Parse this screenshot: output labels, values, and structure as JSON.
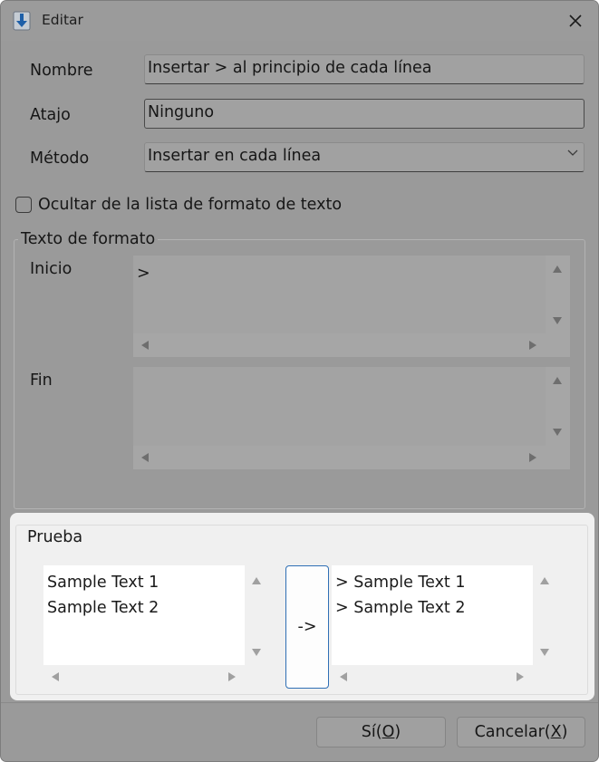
{
  "window": {
    "title": "Editar"
  },
  "form": {
    "nombre_label": "Nombre",
    "nombre_value": "Insertar > al principio de cada línea",
    "atajo_label": "Atajo",
    "atajo_value": "Ninguno",
    "metodo_label": "Método",
    "metodo_value": "Insertar en cada línea",
    "hide_checkbox_label": "Ocultar de la lista de formato de texto",
    "hide_checked": false
  },
  "format_group": {
    "title": "Texto de formato",
    "inicio_label": "Inicio",
    "inicio_value": ">",
    "fin_label": "Fin",
    "fin_value": ""
  },
  "test_group": {
    "title": "Prueba",
    "input_text": "Sample Text 1\nSample Text 2",
    "apply_button": "->",
    "output_text": "> Sample Text 1\n> Sample Text 2"
  },
  "buttons": {
    "ok_prefix": "Sí(",
    "ok_mnemonic": "O",
    "ok_suffix": ")",
    "cancel_prefix": "Cancelar(",
    "cancel_mnemonic": "X",
    "cancel_suffix": ")"
  },
  "icons": {
    "app": "download-arrow-icon",
    "close": "close-icon",
    "dropdown": "chevron-down-icon"
  },
  "colors": {
    "overlay": "#9a9a9a",
    "accent_border": "#2f6fb5",
    "icon_blue": "#1e5fa8",
    "test_panel_bg": "#f0f0f0"
  }
}
